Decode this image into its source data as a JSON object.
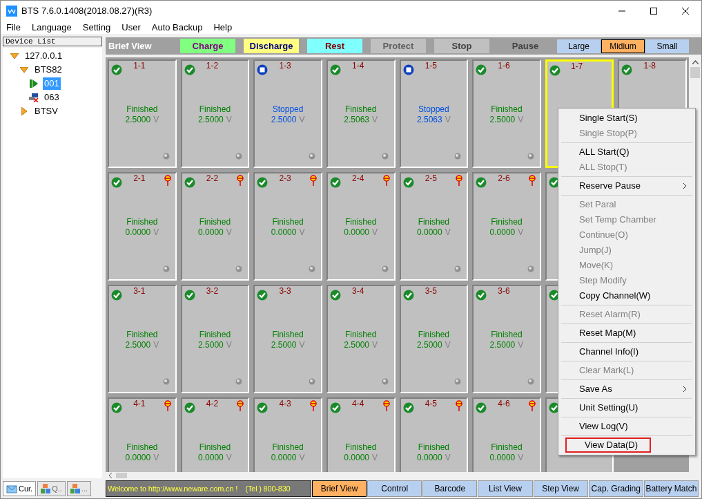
{
  "window": {
    "title": "BTS 7.6.0.1408(2018.08.27)(R3)"
  },
  "menu_bar": [
    "File",
    "Language",
    "Setting",
    "User",
    "Auto Backup",
    "Help"
  ],
  "device_list": {
    "title": "Device List",
    "tree": [
      {
        "label": "127.0.0.1",
        "kind": "host",
        "expanded": true,
        "selected": false,
        "children": [
          {
            "label": "BTS82",
            "kind": "device",
            "expanded": true,
            "selected": false,
            "children": [
              {
                "label": "001",
                "kind": "running",
                "selected": true
              },
              {
                "label": "063",
                "kind": "offline",
                "selected": false
              }
            ]
          },
          {
            "label": "BTSV",
            "kind": "device",
            "expanded": false,
            "selected": false
          }
        ]
      }
    ]
  },
  "left_tabs": [
    {
      "label": "Cur.",
      "kind": "mail",
      "selected": true
    },
    {
      "label": "Q..",
      "kind": "blocks",
      "selected": false
    },
    {
      "label": "...",
      "kind": "blocks",
      "selected": false
    }
  ],
  "header": {
    "title": "Brief View",
    "legend": [
      {
        "label": "Charge",
        "color": "#80ff80",
        "kind": "charge"
      },
      {
        "label": "Discharge",
        "color": "#ffff80",
        "kind": "discharge"
      },
      {
        "label": "Rest",
        "color": "#80ffff",
        "kind": "rest"
      },
      {
        "label": "Protect",
        "color": "#c0c0c0",
        "kind": "protect"
      },
      {
        "label": "Stop",
        "color": "#c0c0c0",
        "kind": "stop"
      },
      {
        "label": "Pause",
        "color": "#a0a0a0",
        "kind": "pause"
      }
    ],
    "sizes": [
      {
        "label": "Large",
        "selected": false
      },
      {
        "label": "Midium",
        "selected": true
      },
      {
        "label": "Small",
        "selected": false
      }
    ]
  },
  "channels": [
    [
      {
        "label": "1-1",
        "kind": "finished",
        "status": "Finished",
        "voltage": "2.5000",
        "unit": "V",
        "pin": false,
        "selected": false
      },
      {
        "label": "1-2",
        "kind": "finished",
        "status": "Finished",
        "voltage": "2.5000",
        "unit": "V",
        "pin": false,
        "selected": false
      },
      {
        "label": "1-3",
        "kind": "stopped",
        "status": "Stopped",
        "voltage": "2.5000",
        "unit": "V",
        "pin": false,
        "selected": false
      },
      {
        "label": "1-4",
        "kind": "finished",
        "status": "Finished",
        "voltage": "2.5063",
        "unit": "V",
        "pin": false,
        "selected": false
      },
      {
        "label": "1-5",
        "kind": "stopped",
        "status": "Stopped",
        "voltage": "2.5063",
        "unit": "V",
        "pin": false,
        "selected": false
      },
      {
        "label": "1-6",
        "kind": "finished",
        "status": "Finished",
        "voltage": "2.5000",
        "unit": "V",
        "pin": false,
        "selected": false
      },
      {
        "label": "1-7",
        "kind": "finished",
        "pin": false,
        "selected": true
      },
      {
        "label": "1-8",
        "kind": "finished",
        "pin": false,
        "selected": false
      }
    ],
    [
      {
        "label": "2-1",
        "kind": "finished",
        "status": "Finished",
        "voltage": "0.0000",
        "unit": "V",
        "pin": true,
        "selected": false
      },
      {
        "label": "2-2",
        "kind": "finished",
        "status": "Finished",
        "voltage": "0.0000",
        "unit": "V",
        "pin": true,
        "selected": false
      },
      {
        "label": "2-3",
        "kind": "finished",
        "status": "Finished",
        "voltage": "0.0000",
        "unit": "V",
        "pin": true,
        "selected": false
      },
      {
        "label": "2-4",
        "kind": "finished",
        "status": "Finished",
        "voltage": "0.0000",
        "unit": "V",
        "pin": true,
        "selected": false
      },
      {
        "label": "2-5",
        "kind": "finished",
        "status": "Finished",
        "voltage": "0.0000",
        "unit": "V",
        "pin": true,
        "selected": false
      },
      {
        "label": "2-6",
        "kind": "finished",
        "status": "Finished",
        "voltage": "0.0000",
        "unit": "V",
        "pin": true,
        "selected": false
      },
      {
        "kind": "finished",
        "pin": false,
        "selected": false
      }
    ],
    [
      {
        "label": "3-1",
        "kind": "finished",
        "status": "Finished",
        "voltage": "2.5000",
        "unit": "V",
        "pin": false,
        "selected": false
      },
      {
        "label": "3-2",
        "kind": "finished",
        "status": "Finished",
        "voltage": "2.5000",
        "unit": "V",
        "pin": false,
        "selected": false
      },
      {
        "label": "3-3",
        "kind": "finished",
        "status": "Finished",
        "voltage": "2.5000",
        "unit": "V",
        "pin": false,
        "selected": false
      },
      {
        "label": "3-4",
        "kind": "finished",
        "status": "Finished",
        "voltage": "2.5000",
        "unit": "V",
        "pin": false,
        "selected": false
      },
      {
        "label": "3-5",
        "kind": "finished",
        "status": "Finished",
        "voltage": "2.5000",
        "unit": "V",
        "pin": false,
        "selected": false
      },
      {
        "label": "3-6",
        "kind": "finished",
        "status": "Finished",
        "voltage": "2.5000",
        "unit": "V",
        "pin": false,
        "selected": false
      },
      {
        "kind": "finished",
        "pin": false,
        "selected": false
      }
    ],
    [
      {
        "label": "4-1",
        "kind": "finished",
        "status": "Finished",
        "voltage": "0.0000",
        "unit": "V",
        "pin": true,
        "selected": false
      },
      {
        "label": "4-2",
        "kind": "finished",
        "status": "Finished",
        "voltage": "0.0000",
        "unit": "V",
        "pin": true,
        "selected": false
      },
      {
        "label": "4-3",
        "kind": "finished",
        "status": "Finished",
        "voltage": "0.0000",
        "unit": "V",
        "pin": true,
        "selected": false
      },
      {
        "label": "4-4",
        "kind": "finished",
        "status": "Finished",
        "voltage": "0.0000",
        "unit": "V",
        "pin": true,
        "selected": false
      },
      {
        "label": "4-5",
        "kind": "finished",
        "status": "Finished",
        "voltage": "0.0000",
        "unit": "V",
        "pin": true,
        "selected": false
      },
      {
        "label": "4-6",
        "kind": "finished",
        "status": "Finished",
        "voltage": "0.0000",
        "unit": "V",
        "pin": true,
        "selected": false
      },
      {
        "kind": "finished",
        "pin": false,
        "selected": false
      }
    ]
  ],
  "context_menu": [
    [
      {
        "label": "Single Start(S)",
        "disabled": false,
        "submenu": false,
        "highlighted": false
      },
      {
        "label": "Single Stop(P)",
        "disabled": true,
        "submenu": false,
        "highlighted": false
      }
    ],
    [
      {
        "label": "ALL Start(Q)",
        "disabled": false,
        "submenu": false,
        "highlighted": false
      },
      {
        "label": "ALL Stop(T)",
        "disabled": true,
        "submenu": false,
        "highlighted": false
      }
    ],
    [
      {
        "label": "Reserve Pause",
        "disabled": false,
        "submenu": true,
        "highlighted": false
      }
    ],
    [
      {
        "label": "Set Paral",
        "disabled": true,
        "submenu": false,
        "highlighted": false
      },
      {
        "label": "Set Temp Chamber",
        "disabled": true,
        "submenu": false,
        "highlighted": false
      },
      {
        "label": "Continue(O)",
        "disabled": true,
        "submenu": false,
        "highlighted": false
      },
      {
        "label": "Jump(J)",
        "disabled": true,
        "submenu": false,
        "highlighted": false
      },
      {
        "label": "Move(K)",
        "disabled": true,
        "submenu": false,
        "highlighted": false
      },
      {
        "label": "Step Modify",
        "disabled": true,
        "submenu": false,
        "highlighted": false
      },
      {
        "label": "Copy Channel(W)",
        "disabled": false,
        "submenu": false,
        "highlighted": false
      }
    ],
    [
      {
        "label": "Reset Alarm(R)",
        "disabled": true,
        "submenu": false,
        "highlighted": false
      }
    ],
    [
      {
        "label": "Reset Map(M)",
        "disabled": false,
        "submenu": false,
        "highlighted": false
      }
    ],
    [
      {
        "label": "Channel Info(I)",
        "disabled": false,
        "submenu": false,
        "highlighted": false
      }
    ],
    [
      {
        "label": "Clear Mark(L)",
        "disabled": true,
        "submenu": false,
        "highlighted": false
      }
    ],
    [
      {
        "label": "Save As",
        "disabled": false,
        "submenu": true,
        "highlighted": false
      }
    ],
    [
      {
        "label": "Unit Setting(U)",
        "disabled": false,
        "submenu": false,
        "highlighted": false
      }
    ],
    [
      {
        "label": "View Log(V)",
        "disabled": false,
        "submenu": false,
        "highlighted": false
      }
    ],
    [
      {
        "label": "View Data(D)",
        "disabled": false,
        "submenu": false,
        "highlighted": true
      }
    ]
  ],
  "status_text": "Welcome to http://www.neware.com.cn !    (Tel ) 800-830",
  "bottom_tabs": [
    {
      "label": "Brief View",
      "selected": true
    },
    {
      "label": "Control",
      "selected": false
    },
    {
      "label": "Barcode",
      "selected": false
    },
    {
      "label": "List View",
      "selected": false
    },
    {
      "label": "Step View",
      "selected": false
    },
    {
      "label": "Cap. Grading",
      "selected": false
    },
    {
      "label": "Battery Match",
      "selected": false
    }
  ]
}
